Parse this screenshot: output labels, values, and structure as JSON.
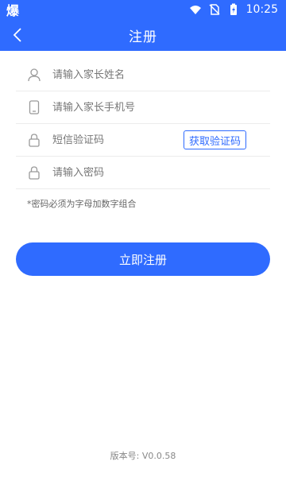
{
  "status_bar": {
    "app_label": "爆",
    "time": "10:25"
  },
  "header": {
    "title": "注册",
    "back_icon": "chevron-left-icon"
  },
  "form": {
    "name_placeholder": "请输入家长姓名",
    "phone_placeholder": "请输入家长手机号",
    "code_placeholder": "短信验证码",
    "get_code_label": "获取验证码",
    "password_placeholder": "请输入密码",
    "password_hint": "*密码必须为字母加数字组合"
  },
  "submit_label": "立即注册",
  "version_text": "版本号: V0.0.58",
  "colors": {
    "primary": "#2f6bff",
    "divider": "#ececec",
    "placeholder": "#777777"
  }
}
